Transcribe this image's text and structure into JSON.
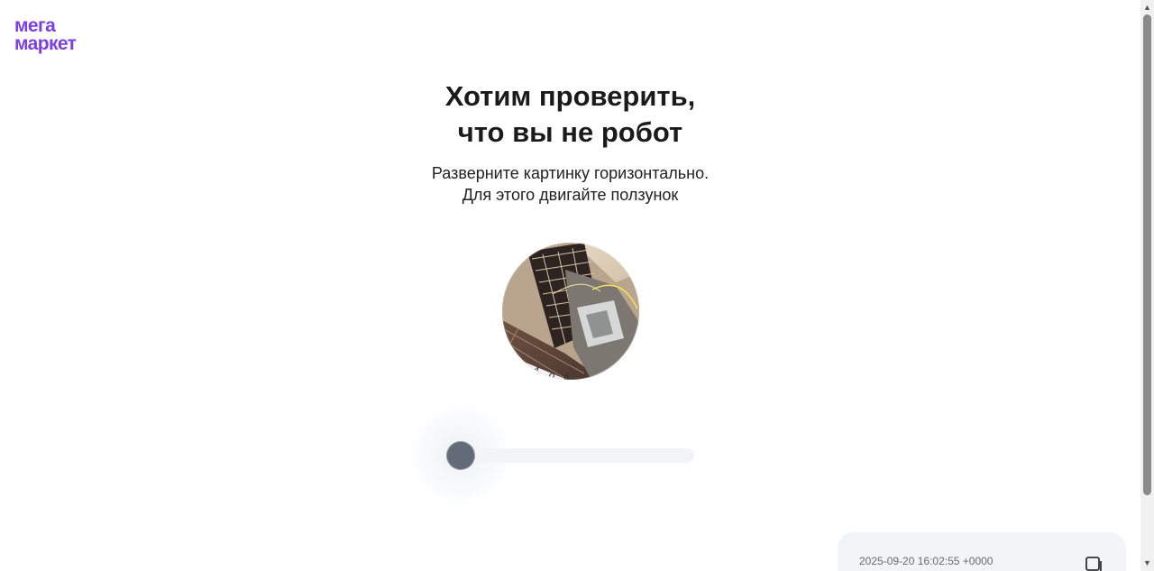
{
  "brand": {
    "line1": "мега",
    "line2": "маркет",
    "color": "#7b3fe4"
  },
  "captcha": {
    "title_line1": "Хотим проверить,",
    "title_line2": "что вы не робот",
    "instruction_line1": "Разверните картинку горизонтально.",
    "instruction_line2": "Для этого двигайте ползунок",
    "image_label": "",
    "slider_progress_percent": 0
  },
  "footer": {
    "timestamp": "2025-09-20 16:02:55 +0000",
    "copy_icon": "copy-icon"
  },
  "scrollbar": {
    "up_icon": "▲",
    "down_icon": "▼"
  },
  "colors": {
    "slider_thumb": "#626b77",
    "slider_track": "#f2f4f7",
    "footer_card": "#f2f5f7"
  }
}
